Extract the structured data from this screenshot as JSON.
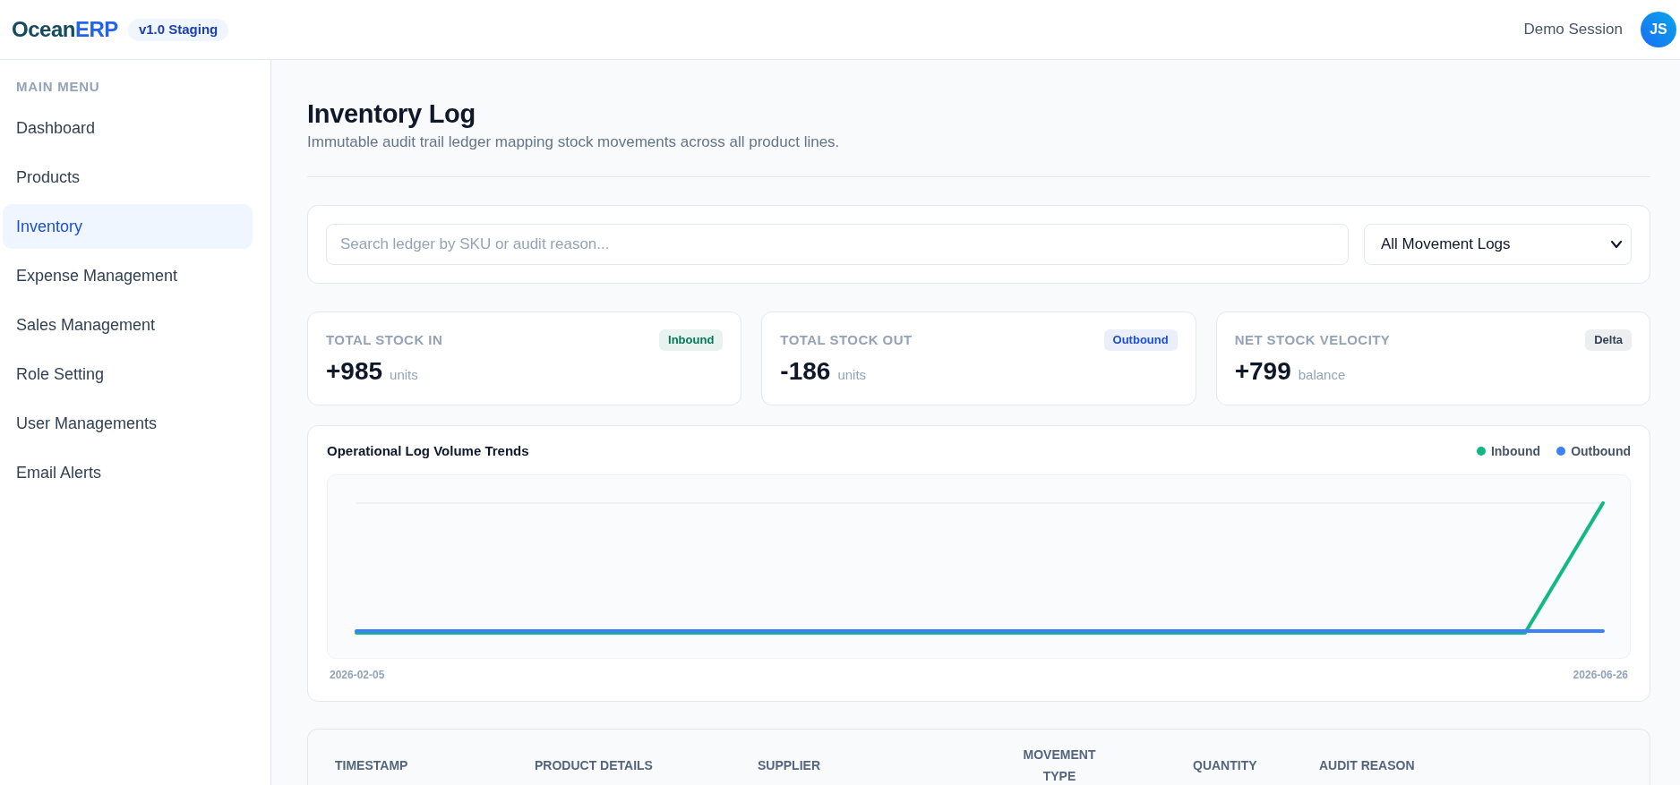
{
  "header": {
    "logo": {
      "primary": "Ocean",
      "accent": "ERP"
    },
    "version_badge": "v1.0 Staging",
    "session_label": "Demo Session",
    "avatar_initials": "JS"
  },
  "sidebar": {
    "section_label": "MAIN MENU",
    "items": [
      {
        "label": "Dashboard",
        "selected": false
      },
      {
        "label": "Products",
        "selected": false
      },
      {
        "label": "Inventory",
        "selected": true
      },
      {
        "label": "Expense Management",
        "selected": false
      },
      {
        "label": "Sales Management",
        "selected": false
      },
      {
        "label": "Role Setting",
        "selected": false
      },
      {
        "label": "User Managements",
        "selected": false
      },
      {
        "label": "Email Alerts",
        "selected": false
      }
    ]
  },
  "page": {
    "title": "Inventory Log",
    "subtitle": "Immutable audit trail ledger mapping stock movements across all product lines."
  },
  "filters": {
    "search": {
      "placeholder": "Search ledger by SKU or audit reason..."
    },
    "movement_select": {
      "value": "All Movement Logs"
    }
  },
  "stats": [
    {
      "label": "TOTAL STOCK IN",
      "badge": {
        "label": "Inbound",
        "color": "#047857"
      },
      "value": "+985",
      "unit": "units"
    },
    {
      "label": "TOTAL STOCK OUT",
      "badge": {
        "label": "Outbound",
        "color": "#1d4ed8"
      },
      "value": "-186",
      "unit": "units"
    },
    {
      "label": "NET STOCK VELOCITY",
      "badge": {
        "label": "Delta",
        "color": "#334155"
      },
      "value": "+799",
      "unit": "balance"
    }
  ],
  "chart": {
    "title": "Operational Log Volume Trends",
    "legend": [
      {
        "label": "Inbound",
        "color": "#10b981"
      },
      {
        "label": "Outbound",
        "color": "#3b82f6"
      }
    ],
    "x_labels": [
      "2026-02-05",
      "2026-06-26"
    ]
  },
  "table": {
    "columns": [
      "TIMESTAMP",
      "PRODUCT DETAILS",
      "SUPPLIER",
      "MOVEMENT TYPE",
      "QUANTITY",
      "AUDIT REASON"
    ]
  }
}
